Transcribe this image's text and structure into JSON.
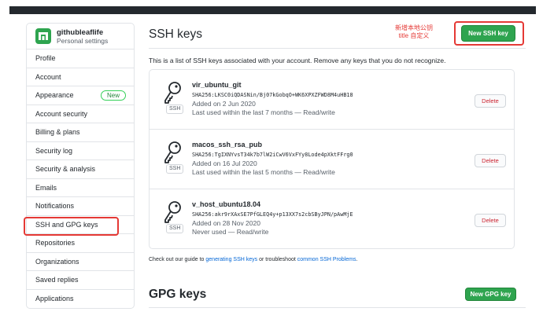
{
  "sidebar": {
    "user_name": "githubleaflife",
    "user_sub": "Personal settings",
    "new_badge": "New",
    "items": [
      {
        "label": "Profile"
      },
      {
        "label": "Account"
      },
      {
        "label": "Appearance"
      },
      {
        "label": "Account security"
      },
      {
        "label": "Billing & plans"
      },
      {
        "label": "Security log"
      },
      {
        "label": "Security & analysis"
      },
      {
        "label": "Emails"
      },
      {
        "label": "Notifications"
      },
      {
        "label": "SSH and GPG keys"
      },
      {
        "label": "Repositories"
      },
      {
        "label": "Organizations"
      },
      {
        "label": "Saved replies"
      },
      {
        "label": "Applications"
      }
    ]
  },
  "ssh": {
    "title": "SSH keys",
    "annotation_line1": "新增本地公钥",
    "annotation_line2": "title 自定义",
    "new_button": "New SSH key",
    "intro": "This is a list of SSH keys associated with your account. Remove any keys that you do not recognize.",
    "ssh_tag": "SSH",
    "delete_label": "Delete",
    "keys": [
      {
        "name": "vir_ubuntu_git",
        "fingerprint": "SHA256:LKSC0iQDASNin/Bj07kGobqO+WK6XPXZFWD8M4uHB18",
        "added": "Added on 2 Jun 2020",
        "last_used": "Last used within the last 7 months — Read/write"
      },
      {
        "name": "macos_ssh_rsa_pub",
        "fingerprint": "SHA256:TgIXNYvsT34k7b7lW2iCwV6VxFYy8Lode4pXktFFrg0",
        "added": "Added on 16 Jul 2020",
        "last_used": "Last used within the last 5 months — Read/write"
      },
      {
        "name": "v_host_ubuntu18.04",
        "fingerprint": "SHA256:akr9rXAxSE7PfGLEQ4y+p13XX7s2cbSByJPN/pAwMjE",
        "added": "Added on 28 Nov 2020",
        "last_used": "Never used — Read/write"
      }
    ],
    "guide_prefix": "Check out our guide to ",
    "guide_link1": "generating SSH keys",
    "guide_middle": " or troubleshoot ",
    "guide_link2": "common SSH Problems",
    "guide_suffix": "."
  },
  "gpg": {
    "title": "GPG keys",
    "new_button": "New GPG key"
  },
  "colors": {
    "accent_green": "#2ea44f",
    "annotation_red": "#e53935",
    "delete_red": "#cb2431",
    "link_blue": "#0366d6"
  }
}
